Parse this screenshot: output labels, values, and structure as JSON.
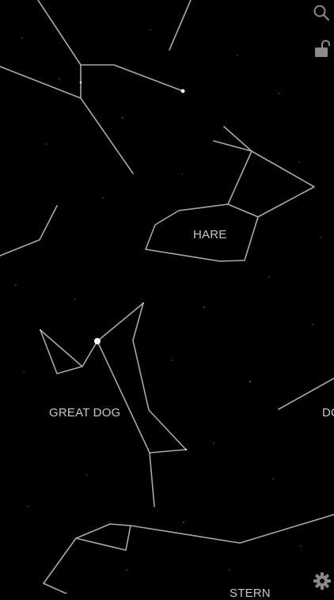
{
  "sky": {
    "background": "#000000",
    "line_color": "#a9a9a9",
    "star_color": "#ffffff"
  },
  "constellations": {
    "hare": {
      "label": "HARE"
    },
    "great_dog": {
      "label": "GREAT DOG"
    },
    "partial_right": {
      "label": "DO"
    },
    "partial_bottom": {
      "label": "STERN"
    }
  },
  "toolbar": {
    "search_icon": "search-icon",
    "lock_icon": "unlocked-icon",
    "settings_icon": "gear-icon",
    "icon_color": "#8a8a8a"
  }
}
